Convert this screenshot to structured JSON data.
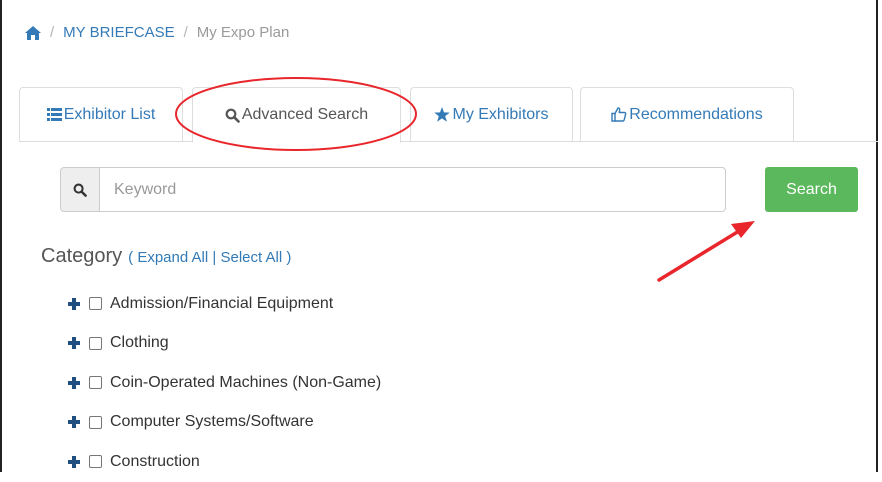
{
  "breadcrumb": {
    "home_icon": "home-icon",
    "separator": "/",
    "items": [
      "MY BRIEFCASE",
      "My Expo Plan"
    ]
  },
  "tabs": [
    {
      "label": "Exhibitor List",
      "icon": "list-icon",
      "active": false
    },
    {
      "label": "Advanced Search",
      "icon": "search-icon",
      "active": true
    },
    {
      "label": "My Exhibitors",
      "icon": "star-icon",
      "active": false
    },
    {
      "label": "Recommendations",
      "icon": "thumbs-up-icon",
      "active": false
    }
  ],
  "search": {
    "placeholder": "Keyword",
    "value": "",
    "button_label": "Search"
  },
  "category": {
    "heading": "Category",
    "open_paren": "(",
    "expand_all": "Expand All",
    "divider": "|",
    "select_all": "Select All",
    "close_paren": ")",
    "items": [
      "Admission/Financial Equipment",
      "Clothing",
      "Coin-Operated Machines (Non-Game)",
      "Computer Systems/Software",
      "Construction"
    ]
  },
  "colors": {
    "link": "#337ab7",
    "search_button": "#5cb85c",
    "annotation": "#e8262c"
  }
}
